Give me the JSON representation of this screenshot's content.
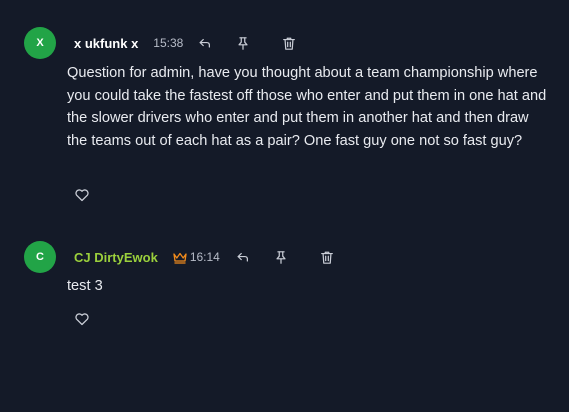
{
  "comments": [
    {
      "avatar_letter": "X",
      "author": "x ukfunk x",
      "time": "15:38",
      "body": "Question for admin, have you thought about a team championship where you could take the fastest off those who enter and put them in one hat and the slower drivers who enter and put them in another hat and then draw the teams out of each hat as a pair? One fast guy one not so fast guy?",
      "author_color": "#ffffff",
      "badge_icon": null
    },
    {
      "avatar_letter": "C",
      "author": "CJ DirtyEwok",
      "time": "16:14",
      "body": "test 3",
      "author_color": "#9bd03c",
      "badge_icon": "crown-icon"
    }
  ],
  "colors": {
    "background": "#141a28",
    "avatar": "#22a447",
    "crown": "#f08a1c",
    "icon": "#c9cdd6"
  },
  "icons": [
    "reply-icon",
    "pin-icon",
    "trash-icon",
    "heart-icon",
    "crown-icon"
  ]
}
